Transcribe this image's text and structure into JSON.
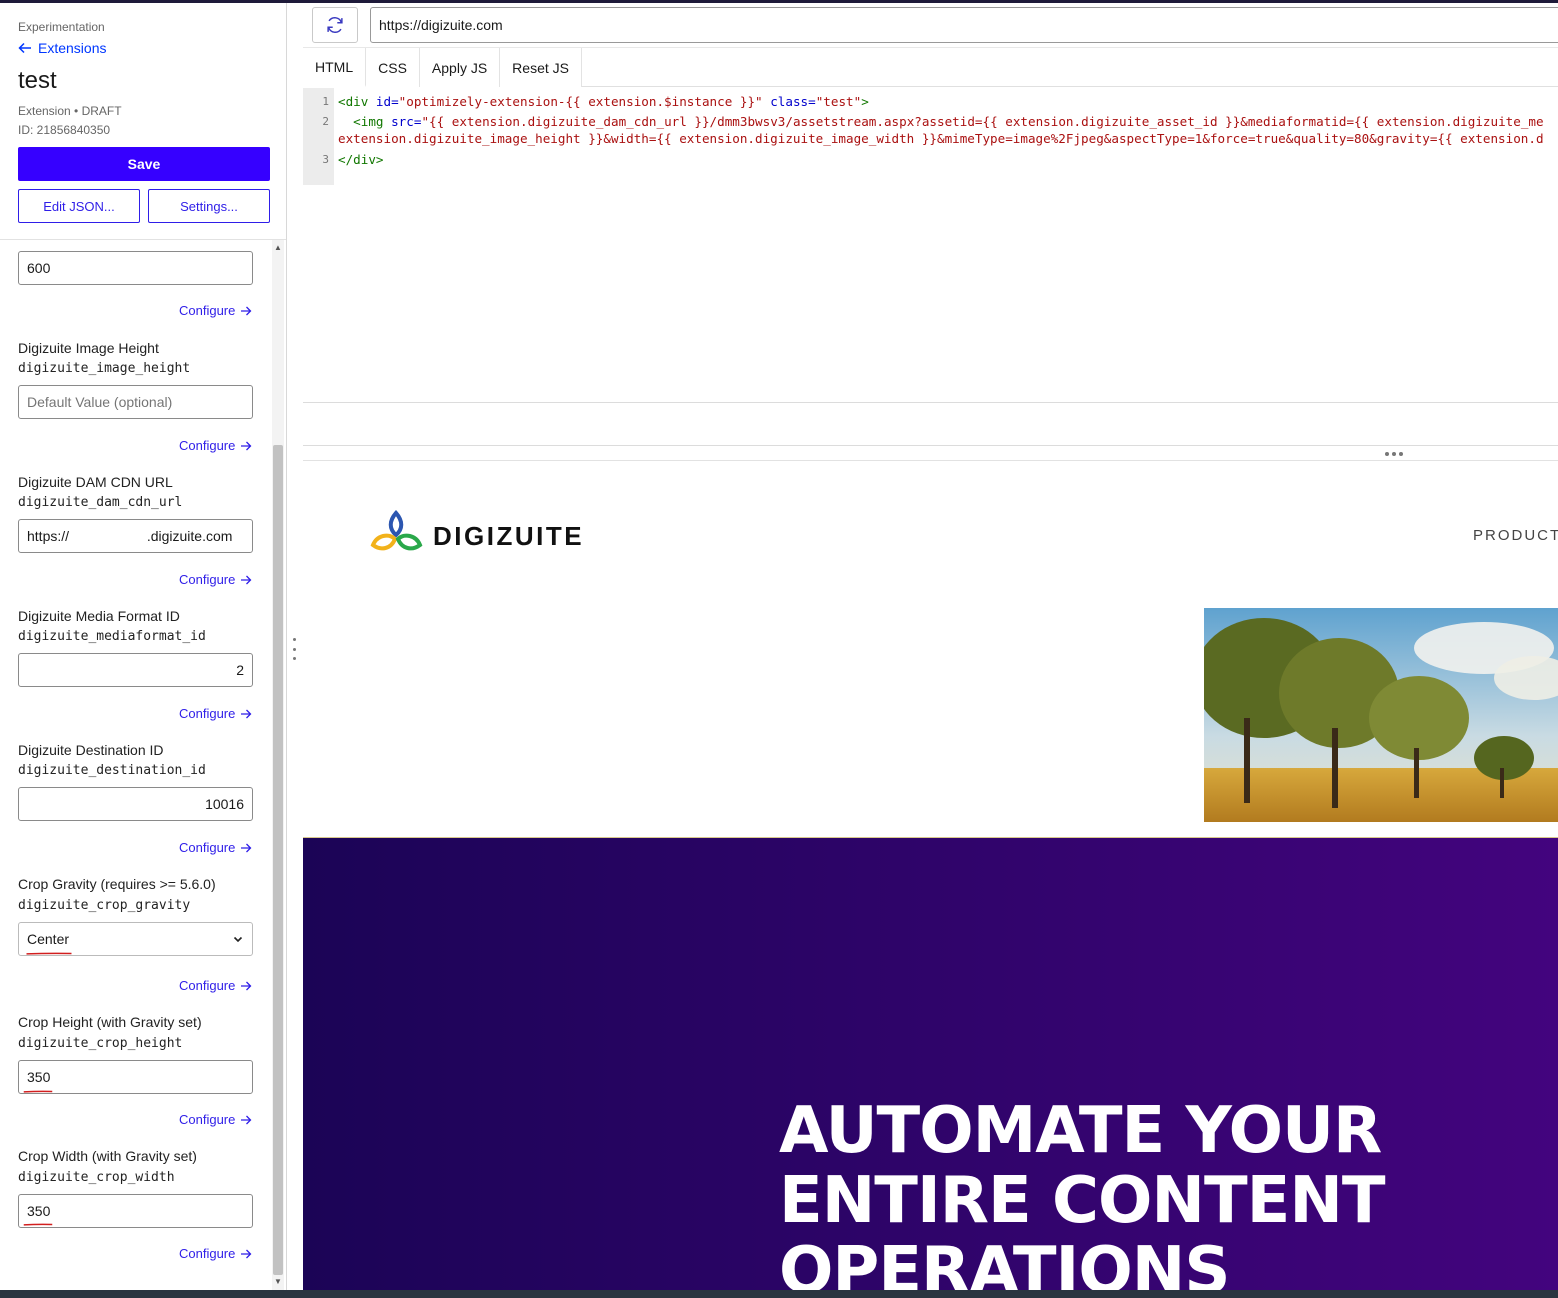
{
  "sidebar": {
    "breadcrumb": "Experimentation",
    "back_label": "Extensions",
    "extension_name": "test",
    "extension_meta": "Extension • DRAFT",
    "extension_id": "ID: 21856840350",
    "save_label": "Save",
    "edit_json_label": "Edit JSON...",
    "settings_label": "Settings...",
    "configure_label": "Configure",
    "top_field_value": "600",
    "fields": [
      {
        "label": "Digizuite Image Height",
        "key": "digizuite_image_height",
        "value": "",
        "placeholder": "Default Value (optional)"
      },
      {
        "label": "Digizuite DAM CDN URL",
        "key": "digizuite_dam_cdn_url",
        "value": "https://                    .digizuite.com",
        "placeholder": ""
      },
      {
        "label": "Digizuite Media Format ID",
        "key": "digizuite_mediaformat_id",
        "value": "2",
        "placeholder": ""
      },
      {
        "label": "Digizuite Destination ID",
        "key": "digizuite_destination_id",
        "value": "10016",
        "placeholder": ""
      },
      {
        "label": "Crop Gravity (requires >= 5.6.0)",
        "key": "digizuite_crop_gravity",
        "selected": "Center"
      },
      {
        "label": "Crop Height (with Gravity set)",
        "key": "digizuite_crop_height",
        "value": "350",
        "placeholder": ""
      },
      {
        "label": "Crop Width (with Gravity set)",
        "key": "digizuite_crop_width",
        "value": "350",
        "placeholder": ""
      }
    ]
  },
  "main": {
    "url": "https://digizuite.com",
    "tabs": [
      {
        "label": "HTML"
      },
      {
        "label": "CSS"
      },
      {
        "label": "Apply JS"
      },
      {
        "label": "Reset JS"
      }
    ],
    "code": {
      "line_numbers": [
        "1",
        "2",
        "3"
      ],
      "l1_open": "<div ",
      "l1_id_attr": "id=",
      "l1_id_val": "\"optimizely-extension-{{ extension.$instance }}\"",
      "l1_class_attr": " class=",
      "l1_class_val": "\"test\"",
      "l1_close": ">",
      "l2_indent": "  ",
      "l2_open": "<img ",
      "l2_src_attr": "src=",
      "l2_src_val_a": "\"{{ extension.digizuite_dam_cdn_url }}/dmm3bwsv3/assetstream.aspx?assetid={{ extension.digizuite_asset_id }}&mediaformatid={{ extension.digizuite_me",
      "l2_src_val_b": "extension.digizuite_image_height }}&width={{ extension.digizuite_image_width }}&mimeType=image%2Fjpeg&aspectType=1&force=true&quality=80&gravity={{ extension.d",
      "l3": "</div>"
    },
    "preview": {
      "logo_text": "DIGIZUITE",
      "nav_product": "PRODUCT",
      "hero_line1": "AUTOMATE YOUR",
      "hero_line2": "ENTIRE CONTENT",
      "hero_line3": "OPERATIONS"
    }
  },
  "colors": {
    "primary": "#3600ff",
    "link": "#2f1ee8",
    "hero_start": "#1b0456",
    "hero_end": "#43047e",
    "annotation_red": "#d21f1f"
  },
  "icons": [
    "arrow-left-icon",
    "arrow-right-icon",
    "chevron-down-icon",
    "refresh-icon",
    "digizuite-logo-icon"
  ]
}
